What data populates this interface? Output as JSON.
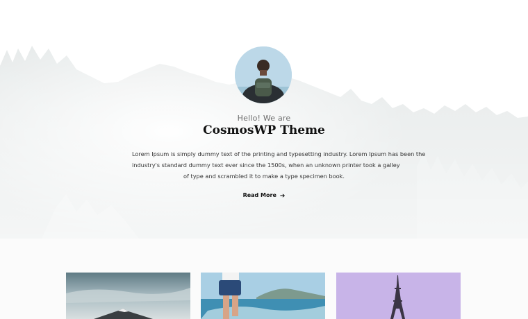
{
  "hero": {
    "greeting": "Hello! We are",
    "title": "CosmosWP Theme",
    "description_lines": [
      "Lorem Ipsum is simply dummy text of the printing and typesetting industry. Lorem Ipsum has been the",
      "industry's standard dummy text ever since the 1500s, when an unknown printer took a galley",
      "of type and scrambled it to make a type specimen book."
    ],
    "cta_label": "Read More",
    "cta_icon": "arrow-right-icon"
  },
  "colors": {
    "text_dark": "#111111",
    "text_muted": "#6b6b6b",
    "fog": "#e9eded",
    "sky_blue": "#bcd8e8",
    "lavender": "#c8b4e8"
  },
  "posts": [
    {
      "image": "mountain-landscape-image"
    },
    {
      "image": "beach-person-image"
    },
    {
      "image": "eiffel-tower-image"
    }
  ]
}
